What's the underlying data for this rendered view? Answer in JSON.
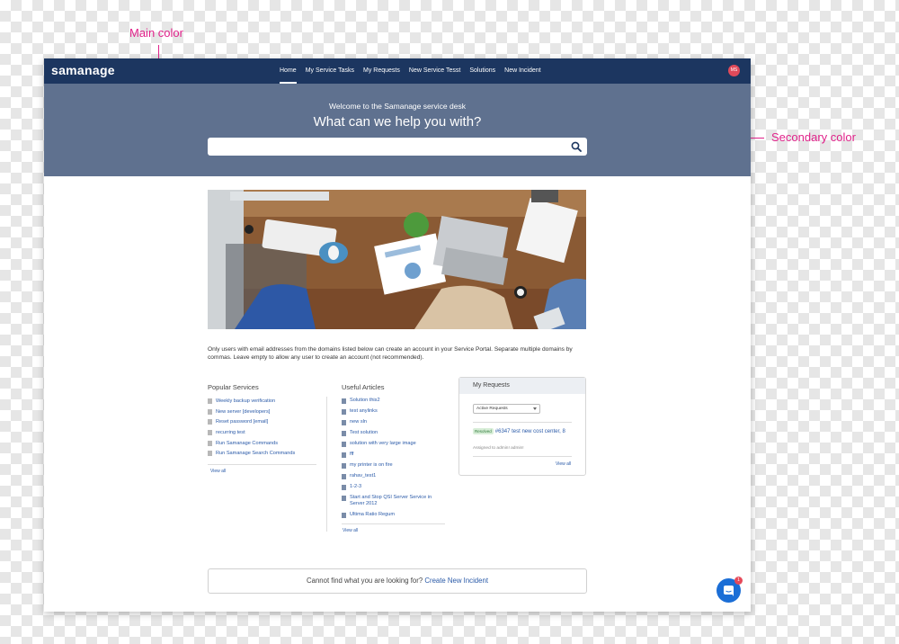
{
  "annotations": {
    "main_color": "Main color",
    "secondary_color": "Secondary color"
  },
  "colors": {
    "main": "#1c3660",
    "secondary": "#5f718f",
    "link": "#2a5aa8",
    "annotation": "#e0228a"
  },
  "topbar": {
    "logo": "samanage",
    "nav": [
      "Home",
      "My Service Tasks",
      "My Requests",
      "New Service Tesst",
      "Solutions",
      "New Incident"
    ],
    "active_nav": "Home",
    "avatar_initials": "MS"
  },
  "hero": {
    "welcome": "Welcome to the Samanage service desk",
    "title": "What can we help you with?",
    "search_placeholder": ""
  },
  "notice": "Only users with email addresses from the domains listed below can create an account in your Service Portal. Separate multiple domains by commas. Leave empty to allow any user to create an account (not recommended).",
  "popular_services": {
    "title": "Popular Services",
    "items": [
      "Weekly backup verification",
      "New server [developers]",
      "Reset password [email]",
      "recurring test",
      "Run Samanage Commands",
      "Run Samanage Search Commands"
    ],
    "view_all": "View all"
  },
  "useful_articles": {
    "title": "Useful Articles",
    "items": [
      "Solution this2",
      "test anylinks",
      "new sln",
      "Test solution",
      "solution with very large image",
      "fff",
      "my printer is on fire",
      "rahav_test1",
      "1-2-3",
      "Start and Stop QSI Server Service in Server 2012",
      "Ultima Ratio Regum"
    ],
    "view_all": "View all"
  },
  "my_requests": {
    "title": "My Requests",
    "filter": "Active Requests",
    "request": {
      "status": "Resolved",
      "title": "#6347 test new cost center, 8",
      "assigned": "Assigned to admin! admin!"
    },
    "view_all": "View all"
  },
  "footer_prompt": {
    "text": "Cannot find what you are looking for?",
    "link": "Create New Incident"
  },
  "chat": {
    "icon": "chat-bubble-icon",
    "badge_count": "1"
  }
}
